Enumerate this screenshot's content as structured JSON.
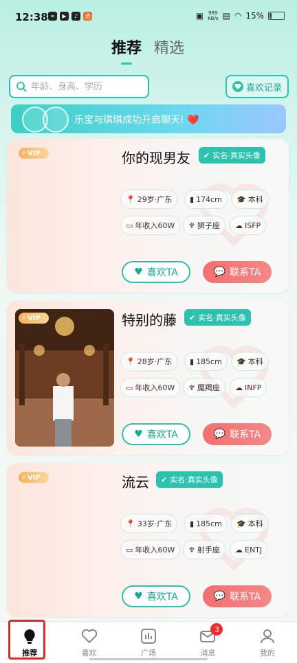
{
  "status_bar": {
    "time": "12:38",
    "net_speed": "989",
    "net_unit": "KB/s",
    "battery": "15%"
  },
  "tabs": [
    {
      "label": "推荐"
    },
    {
      "label": "精选"
    }
  ],
  "search": {
    "placeholder": "年龄、身高、学历"
  },
  "likes_record": {
    "label": "喜欢记录"
  },
  "banner": {
    "text": "乐宝与琪琪成功开启聊天! ❤️"
  },
  "vip_label": "VIP",
  "verify_label": "实名·真实头像",
  "like_button": "喜欢TA",
  "contact_button": "联系TA",
  "profiles": [
    {
      "name": "你的现男友",
      "age_region": "29岁·广东",
      "height": "174cm",
      "education": "本科",
      "income": "年收入60W",
      "zodiac": "狮子座",
      "mbti": "ISFP"
    },
    {
      "name": "特别的藤",
      "age_region": "28岁·广东",
      "height": "185cm",
      "education": "本科",
      "income": "年收入60W",
      "zodiac": "魔羯座",
      "mbti": "INFP"
    },
    {
      "name": "流云",
      "age_region": "33岁·广东",
      "height": "185cm",
      "education": "本科",
      "income": "年收入60W",
      "zodiac": "射手座",
      "mbti": "ENTJ"
    }
  ],
  "nav": [
    {
      "label": "推荐",
      "icon": "bulb-icon"
    },
    {
      "label": "喜欢",
      "icon": "heart-icon"
    },
    {
      "label": "广场",
      "icon": "chart-icon"
    },
    {
      "label": "消息",
      "icon": "mail-icon",
      "badge": "3"
    },
    {
      "label": "我的",
      "icon": "person-icon"
    }
  ],
  "colors": {
    "accent": "#2cc2ae",
    "contact": "#f26f6f",
    "badge": "#ef2b2b"
  }
}
